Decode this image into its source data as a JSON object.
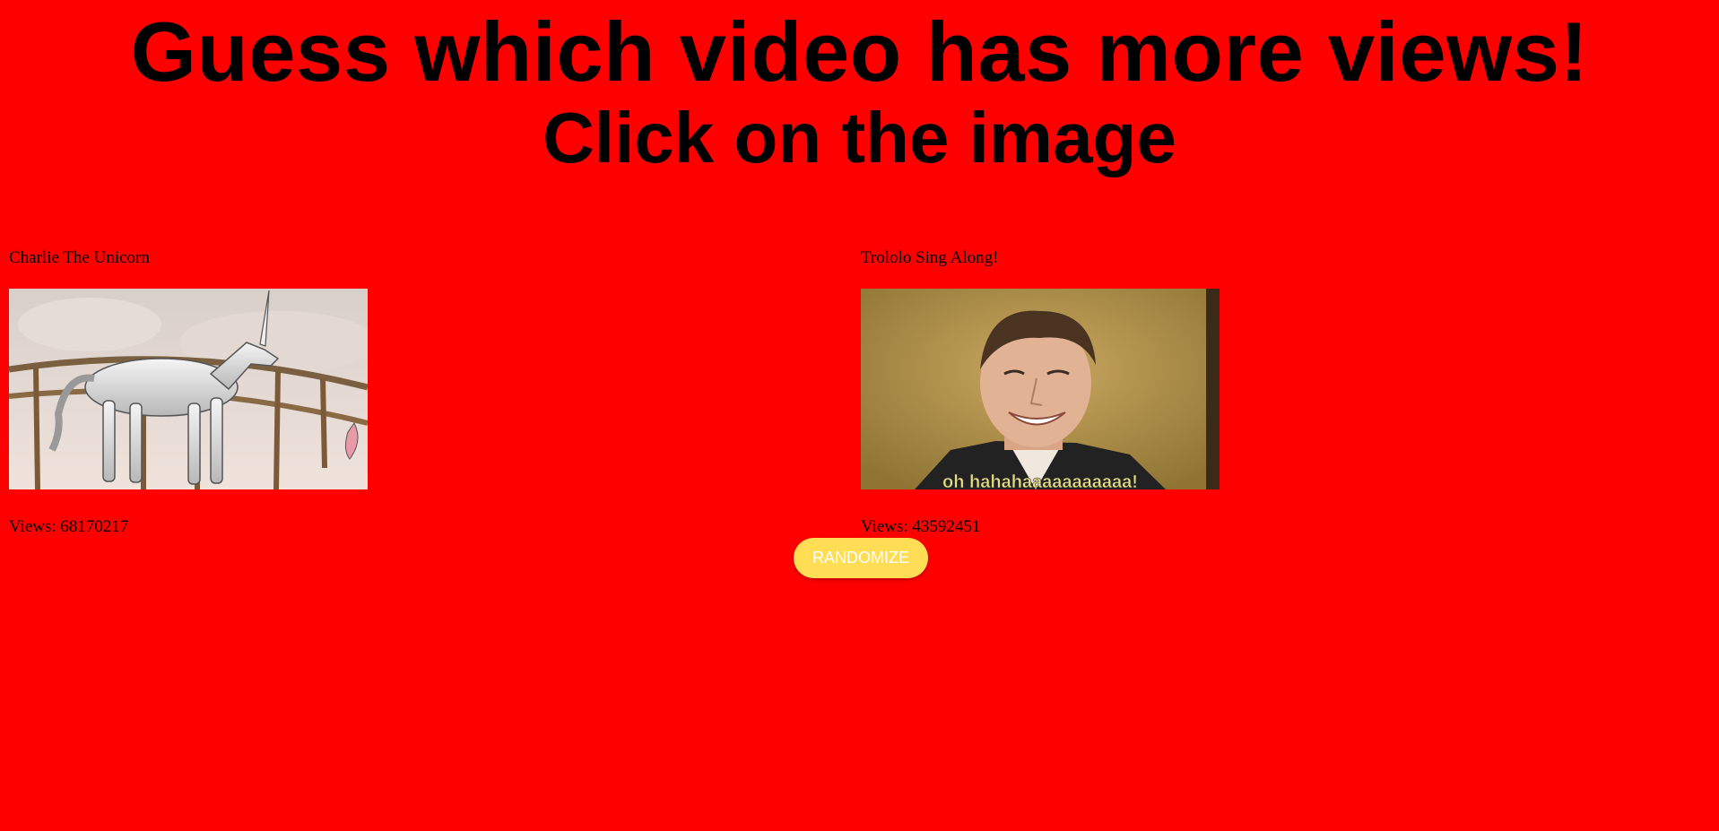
{
  "header": {
    "title": "Guess which video has more views!",
    "subtitle": "Click on the image"
  },
  "videos": [
    {
      "title": "Charlie The Unicorn",
      "views_label": "Views: 68170217",
      "thumbnail": "unicorn-thumbnail"
    },
    {
      "title": "Trololo Sing Along!",
      "views_label": "Views: 43592451",
      "thumbnail": "trololo-thumbnail",
      "caption": "oh hahahaaaaaaaaaaa!"
    }
  ],
  "controls": {
    "randomize_label": "RANDOMIZE"
  },
  "colors": {
    "background": "#ff0000",
    "button": "#ffdd55",
    "button_text": "#ffffff"
  }
}
